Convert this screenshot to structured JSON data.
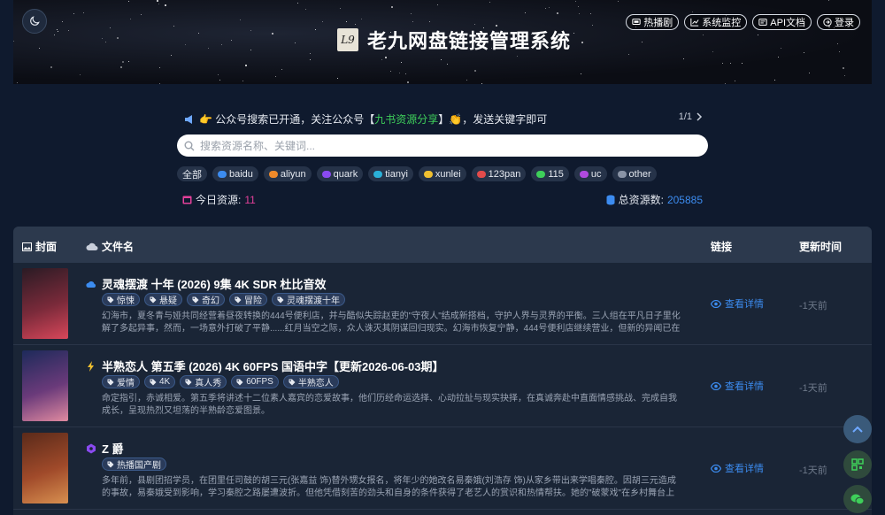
{
  "header": {
    "title": "老九网盘链接管理系统",
    "logo_text": "L9",
    "links": [
      {
        "label": "热播剧",
        "icon": "tv-icon"
      },
      {
        "label": "系统监控",
        "icon": "chart-icon"
      },
      {
        "label": "API文档",
        "icon": "api-icon"
      },
      {
        "label": "登录",
        "icon": "login-icon"
      }
    ]
  },
  "notice": {
    "prefix": "👉 公众号搜索已开通，关注公众号【",
    "highlight": "九书资源分享",
    "suffix": "】",
    "emoji": "👏",
    "tail": "，发送关键字即可",
    "page": "1/1"
  },
  "search": {
    "placeholder": "搜索资源名称、关键词..."
  },
  "chips": [
    {
      "label": "全部",
      "color": ""
    },
    {
      "label": "baidu",
      "color": "#3c8cf0"
    },
    {
      "label": "aliyun",
      "color": "#f08a2a"
    },
    {
      "label": "quark",
      "color": "#8a4af0"
    },
    {
      "label": "tianyi",
      "color": "#2ab0d8"
    },
    {
      "label": "xunlei",
      "color": "#f0c030"
    },
    {
      "label": "123pan",
      "color": "#e34b4b"
    },
    {
      "label": "115",
      "color": "#3ecf5a"
    },
    {
      "label": "uc",
      "color": "#b04ae0"
    },
    {
      "label": "other",
      "color": "#8a94a6"
    }
  ],
  "stats": {
    "today_label": "今日资源:",
    "today_value": "11",
    "total_label": "总资源数:",
    "total_value": "205885"
  },
  "table": {
    "headers": {
      "cover": "封面",
      "name": "文件名",
      "link": "链接",
      "time": "更新时间"
    },
    "rows": [
      {
        "icon": "cloud-icon",
        "icon_color": "#3c8cf0",
        "title": "灵魂摆渡 十年 (2026) 9集 4K SDR 杜比音效",
        "tags": [
          "惊悚",
          "悬疑",
          "奇幻",
          "冒险",
          "灵魂摆渡十年"
        ],
        "desc": "幻海市，夏冬青与娅共同经营着昼夜转换的444号便利店，并与酷似失踪赵吏的\"守夜人\"结成新搭档，守护人界与灵界的平衡。三人组在平凡日子里化解了多起异事，然而，一场意外打破了平静......红月当空之际，众人诛灭其阴谋回归现实。幻海市恢复宁静，444号便利店继续营业，但新的异闻已在青石板路上悄...",
        "detail": "查看详情",
        "time": "-1天前"
      },
      {
        "icon": "bolt-icon",
        "icon_color": "#f0c030",
        "title": "半熟恋人 第五季 (2026) 4K 60FPS 国语中字【更新2026-06-03期】",
        "tags": [
          "爱情",
          "4K",
          "真人秀",
          "60FPS",
          "半熟恋人"
        ],
        "desc": "命定指引，赤诚相爱。第五季将讲述十二位素人嘉宾的恋爱故事，他们历经命运选择、心动拉扯与现实抉择，在真诚奔赴中直面情感挑战、完成自我成长，呈现热烈又坦荡的半熟龄恋爱图景。",
        "detail": "查看详情",
        "time": "-1天前"
      },
      {
        "icon": "hex-icon",
        "icon_color": "#8a4af0",
        "title": "Z 爵",
        "tags": [
          "热播国产剧"
        ],
        "desc": "多年前，县剧团招学员，在团里任司鼓的胡三元(张嘉益 饰)替外甥女报名，将年少的她改名易秦娥(刘浩存 饰)从家乡带出来学唱秦腔。因胡三元造成的事故，易秦娥受到影响，学习秦腔之路屡遭波折。但他凭借刻苦的劲头和自身的条件获得了老艺人的赏识和热情帮扶。她的\"破蒙戏\"在乡村舞台上音惊四座，后改名...",
        "detail": "查看详情",
        "time": "-1天前"
      }
    ]
  }
}
